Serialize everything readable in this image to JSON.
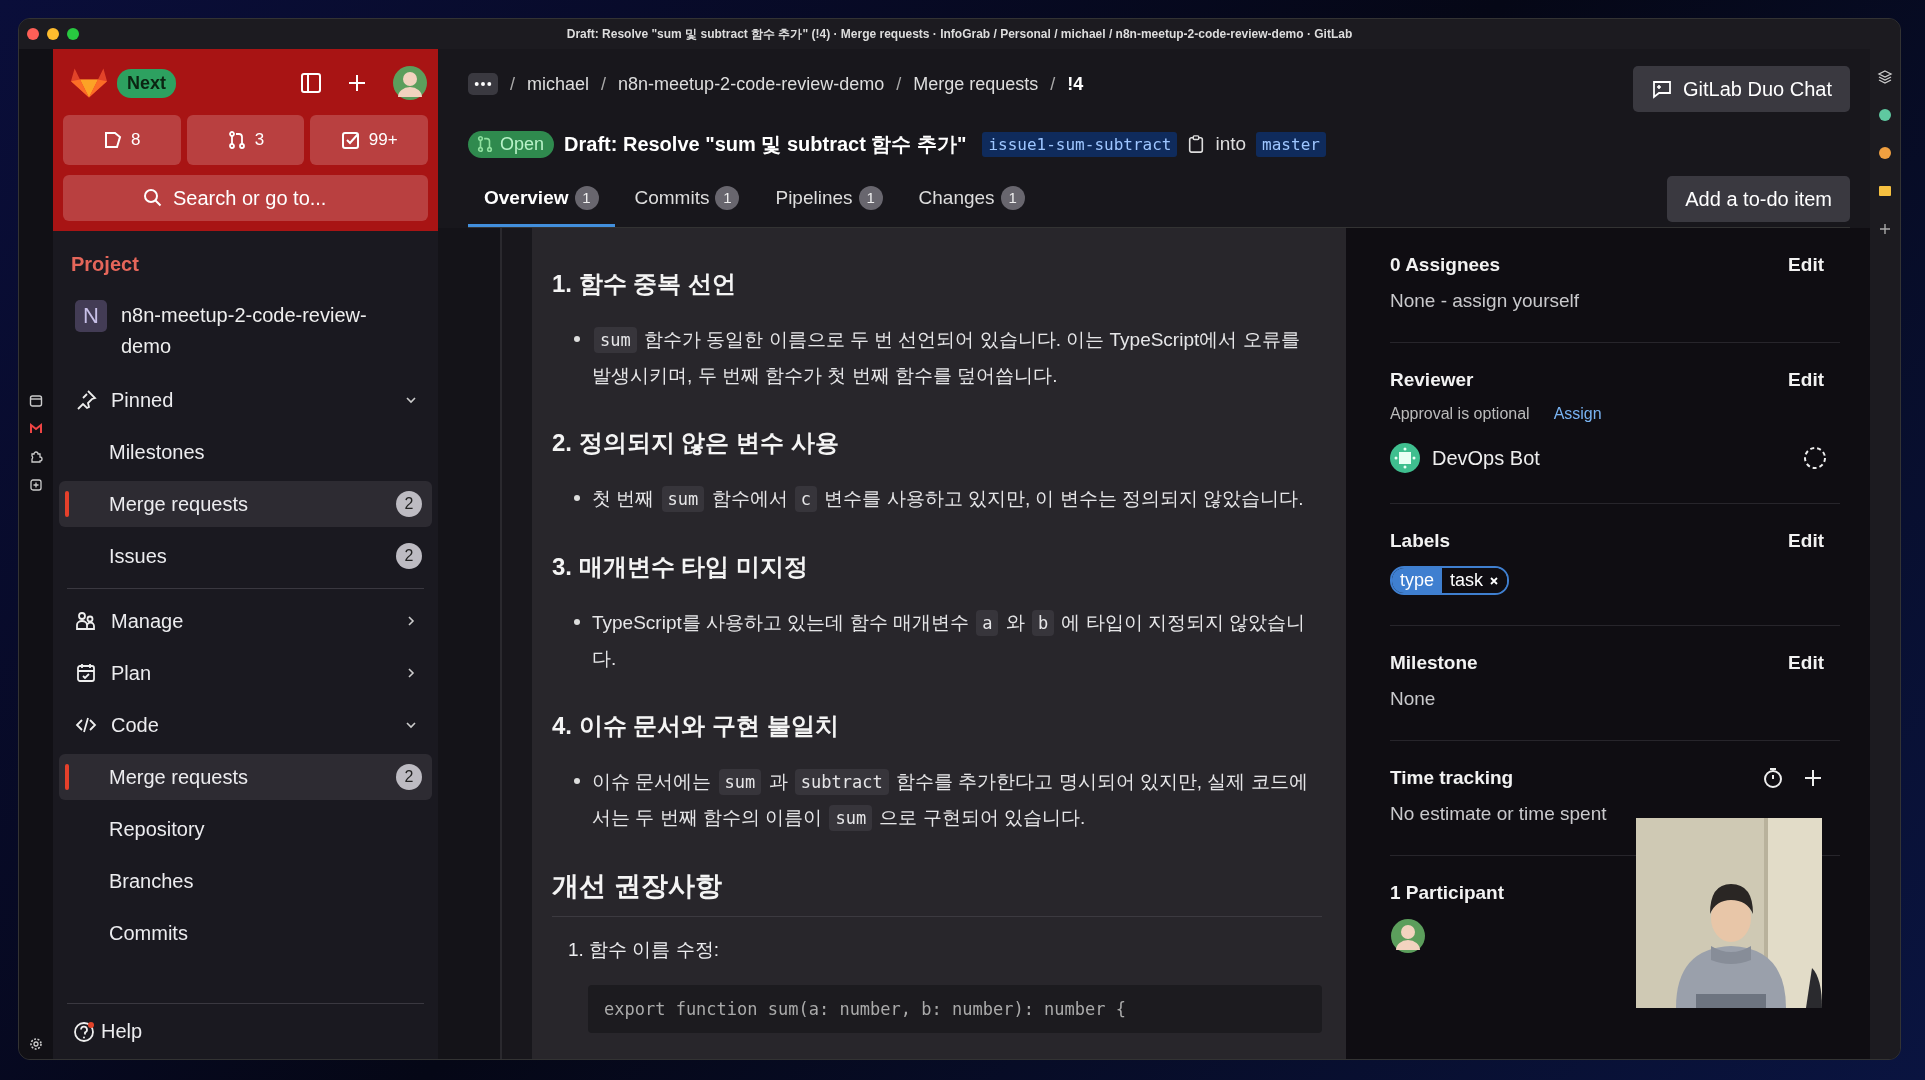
{
  "window": {
    "title": "Draft: Resolve \"sum 및 subtract 함수 추가\" (!4) · Merge requests · InfoGrab / Personal / michael / n8n-meetup-2-code-review-demo · GitLab"
  },
  "sidebar": {
    "badge": "Next",
    "counters": [
      {
        "count": "8"
      },
      {
        "count": "3"
      },
      {
        "count": "99+"
      }
    ],
    "search": {
      "placeholder": "Search or go to..."
    },
    "section": "Project",
    "project": {
      "initial": "N",
      "name": "n8n-meetup-2-code-review-demo"
    },
    "nav": [
      {
        "label": "Pinned",
        "expanded": true,
        "children": [
          {
            "label": "Milestones",
            "selected": false
          },
          {
            "label": "Merge requests",
            "count": "2",
            "selected": true
          },
          {
            "label": "Issues",
            "count": "2",
            "selected": false
          }
        ]
      },
      {
        "label": "Manage",
        "expanded": false
      },
      {
        "label": "Plan",
        "expanded": false
      },
      {
        "label": "Code",
        "expanded": true,
        "children": [
          {
            "label": "Merge requests",
            "count": "2",
            "selected": true
          },
          {
            "label": "Repository",
            "selected": false
          },
          {
            "label": "Branches",
            "selected": false
          },
          {
            "label": "Commits",
            "selected": false
          }
        ]
      }
    ],
    "help": "Help"
  },
  "breadcrumb": [
    "michael",
    "n8n-meetup-2-code-review-demo",
    "Merge requests",
    "!4"
  ],
  "breadcrumb_separator": "/",
  "duo_button": "GitLab Duo Chat",
  "merge_request": {
    "status": "Open",
    "title": "Draft: Resolve \"sum 및 subtract 함수 추가\"",
    "source_branch": "issue1-sum-subtract",
    "into": "into",
    "target_branch": "master"
  },
  "tabs": [
    {
      "label": "Overview",
      "count": "1",
      "selected": true
    },
    {
      "label": "Commits",
      "count": "1",
      "selected": false
    },
    {
      "label": "Pipelines",
      "count": "1",
      "selected": false
    },
    {
      "label": "Changes",
      "count": "1",
      "selected": false
    }
  ],
  "todo_button": "Add a to-do item",
  "article": [
    {
      "kind": "h3",
      "text": "1. 함수 중복 선언"
    },
    {
      "kind": "bullet",
      "parts": [
        {
          "kind": "code",
          "text": "sum"
        },
        {
          "kind": "text",
          "text": " 함수가 동일한 이름으로 두 번 선언되어 있습니다. 이는 TypeScript에서 오류를 발생시키며, 두 번째 함수가 첫 번째 함수를 덮어씁니다."
        }
      ]
    },
    {
      "kind": "h3",
      "text": "2. 정의되지 않은 변수 사용"
    },
    {
      "kind": "bullet",
      "parts": [
        {
          "kind": "text",
          "text": "첫 번째 "
        },
        {
          "kind": "code",
          "text": "sum"
        },
        {
          "kind": "text",
          "text": " 함수에서 "
        },
        {
          "kind": "code",
          "text": "c"
        },
        {
          "kind": "text",
          "text": " 변수를 사용하고 있지만, 이 변수는 정의되지 않았습니다."
        }
      ]
    },
    {
      "kind": "h3",
      "text": "3. 매개변수 타입 미지정"
    },
    {
      "kind": "bullet",
      "parts": [
        {
          "kind": "text",
          "text": "TypeScript를 사용하고 있는데 함수 매개변수 "
        },
        {
          "kind": "code",
          "text": "a"
        },
        {
          "kind": "text",
          "text": " 와 "
        },
        {
          "kind": "code",
          "text": "b"
        },
        {
          "kind": "text",
          "text": " 에 타입이 지정되지 않았습니다."
        }
      ]
    },
    {
      "kind": "h3",
      "text": "4. 이슈 문서와 구현 불일치"
    },
    {
      "kind": "bullet",
      "parts": [
        {
          "kind": "text",
          "text": "이슈 문서에는 "
        },
        {
          "kind": "code",
          "text": "sum"
        },
        {
          "kind": "text",
          "text": " 과 "
        },
        {
          "kind": "code",
          "text": "subtract"
        },
        {
          "kind": "text",
          "text": " 함수를 추가한다고 명시되어 있지만, 실제 코드에서는 두 번째 함수의 이름이 "
        },
        {
          "kind": "code",
          "text": "sum"
        },
        {
          "kind": "text",
          "text": " 으로 구현되어 있습니다."
        }
      ]
    },
    {
      "kind": "h2",
      "text": "개선 권장사항"
    },
    {
      "kind": "numbered",
      "text": "1. 함수 이름 수정:"
    },
    {
      "kind": "code",
      "text": "export function sum(a: number, b: number): number {"
    }
  ],
  "panel": {
    "assignees": {
      "title": "0 Assignees",
      "edit": "Edit",
      "value": "None - assign yourself"
    },
    "reviewer": {
      "title": "Reviewer",
      "edit": "Edit",
      "note": "Approval is optional",
      "link": "Assign",
      "name": "DevOps Bot"
    },
    "labels": {
      "title": "Labels",
      "edit": "Edit",
      "scope": "type",
      "name": "task"
    },
    "milestone": {
      "title": "Milestone",
      "edit": "Edit",
      "value": "None"
    },
    "time_tracking": {
      "title": "Time tracking",
      "value": "No estimate or time spent"
    },
    "participants": {
      "title": "1 Participant"
    }
  },
  "webcam": {
    "kind": "picture"
  }
}
